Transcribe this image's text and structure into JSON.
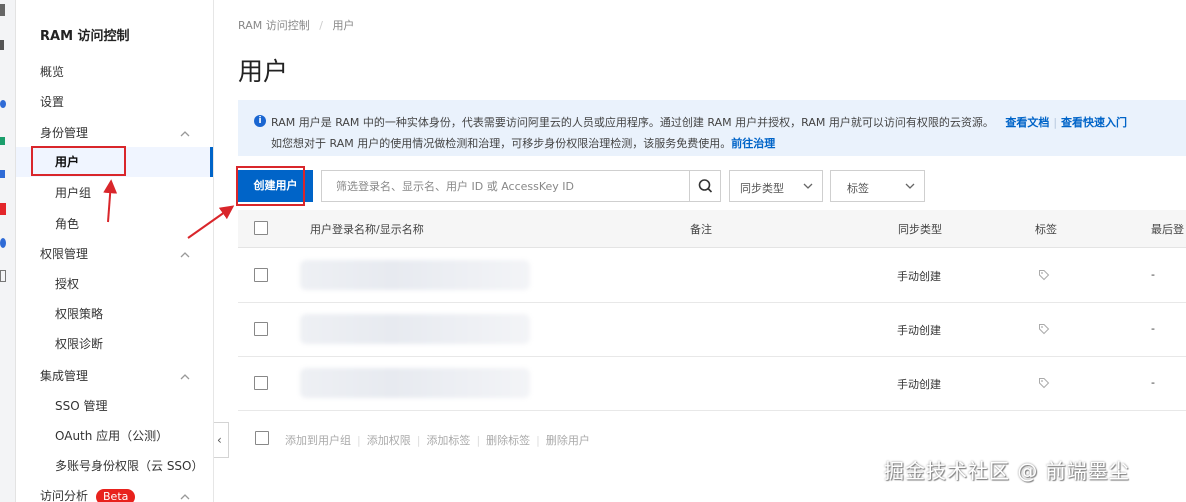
{
  "sidebar": {
    "title": "RAM 访问控制",
    "items": [
      {
        "label": "概览",
        "type": "item"
      },
      {
        "label": "设置",
        "type": "item"
      },
      {
        "label": "身份管理",
        "type": "group"
      },
      {
        "label": "用户",
        "type": "sub",
        "active": true
      },
      {
        "label": "用户组",
        "type": "sub"
      },
      {
        "label": "角色",
        "type": "sub"
      },
      {
        "label": "权限管理",
        "type": "group"
      },
      {
        "label": "授权",
        "type": "sub"
      },
      {
        "label": "权限策略",
        "type": "sub"
      },
      {
        "label": "权限诊断",
        "type": "sub"
      },
      {
        "label": "集成管理",
        "type": "group"
      },
      {
        "label": "SSO 管理",
        "type": "sub"
      },
      {
        "label": "OAuth 应用（公测）",
        "type": "sub"
      },
      {
        "label": "多账号身份权限（云 SSO）",
        "type": "sub"
      },
      {
        "label": "访问分析",
        "type": "group"
      }
    ],
    "beta_badge": "Beta",
    "collapse_glyph": "‹"
  },
  "breadcrumb": {
    "root": "RAM 访问控制",
    "separator": "/",
    "current": "用户"
  },
  "page_title": "用户",
  "info": {
    "line1": "RAM 用户是 RAM 中的一种实体身份，代表需要访问阿里云的人员或应用程序。通过创建 RAM 用户并授权，RAM 用户就可以访问有权限的云资源。",
    "link_docs": "查看文档",
    "link_quickstart": "查看快速入门",
    "line2": "如您想对于 RAM 用户的使用情况做检测和治理，可移步身份权限治理检测，该服务免费使用。",
    "link_governance": "前往治理"
  },
  "toolbar": {
    "create_label": "创建用户",
    "search_placeholder": "筛选登录名、显示名、用户 ID 或 AccessKey ID",
    "sync_type_label": "同步类型",
    "tag_label": "标签"
  },
  "table": {
    "columns": [
      "用户登录名称/显示名称",
      "备注",
      "同步类型",
      "标签",
      "最后登"
    ],
    "rows": [
      {
        "sync_type": "手动创建",
        "last_login": "-"
      },
      {
        "sync_type": "手动创建",
        "last_login": "-"
      },
      {
        "sync_type": "手动创建",
        "last_login": "-"
      }
    ]
  },
  "bulk_actions": [
    "添加到用户组",
    "添加权限",
    "添加标签",
    "删除标签",
    "删除用户"
  ],
  "watermark": "掘金技术社区 @ 前端墨尘",
  "colors": {
    "primary": "#0064c8",
    "info_bg": "#eaf2fc",
    "annotation_red": "#d9262b",
    "beta": "#e8221d"
  }
}
